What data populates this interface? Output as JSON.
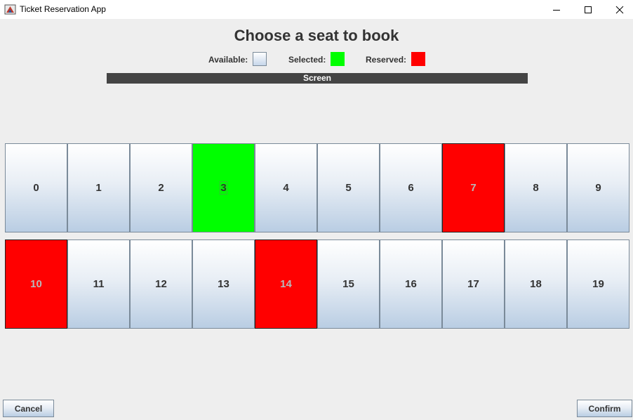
{
  "window": {
    "title": "Ticket Reservation App",
    "icons": {
      "app": "java-app-icon",
      "minimize": "minimize-icon",
      "maximize": "maximize-icon",
      "close": "close-icon"
    }
  },
  "header": {
    "title": "Choose a seat to book"
  },
  "legend": {
    "available_label": "Available:",
    "selected_label": "Selected:",
    "reserved_label": "Reserved:"
  },
  "screen_label": "Screen",
  "colors": {
    "selected": "#00ff00",
    "reserved": "#ff0000",
    "screen": "#444444"
  },
  "seats": [
    {
      "label": "0",
      "status": "available"
    },
    {
      "label": "1",
      "status": "available"
    },
    {
      "label": "2",
      "status": "available"
    },
    {
      "label": "3",
      "status": "selected"
    },
    {
      "label": "4",
      "status": "available"
    },
    {
      "label": "5",
      "status": "available"
    },
    {
      "label": "6",
      "status": "available"
    },
    {
      "label": "7",
      "status": "reserved"
    },
    {
      "label": "8",
      "status": "available"
    },
    {
      "label": "9",
      "status": "available"
    },
    {
      "label": "10",
      "status": "reserved"
    },
    {
      "label": "11",
      "status": "available"
    },
    {
      "label": "12",
      "status": "available"
    },
    {
      "label": "13",
      "status": "available"
    },
    {
      "label": "14",
      "status": "reserved"
    },
    {
      "label": "15",
      "status": "available"
    },
    {
      "label": "16",
      "status": "available"
    },
    {
      "label": "17",
      "status": "available"
    },
    {
      "label": "18",
      "status": "available"
    },
    {
      "label": "19",
      "status": "available"
    }
  ],
  "buttons": {
    "cancel": "Cancel",
    "confirm": "Confirm"
  }
}
